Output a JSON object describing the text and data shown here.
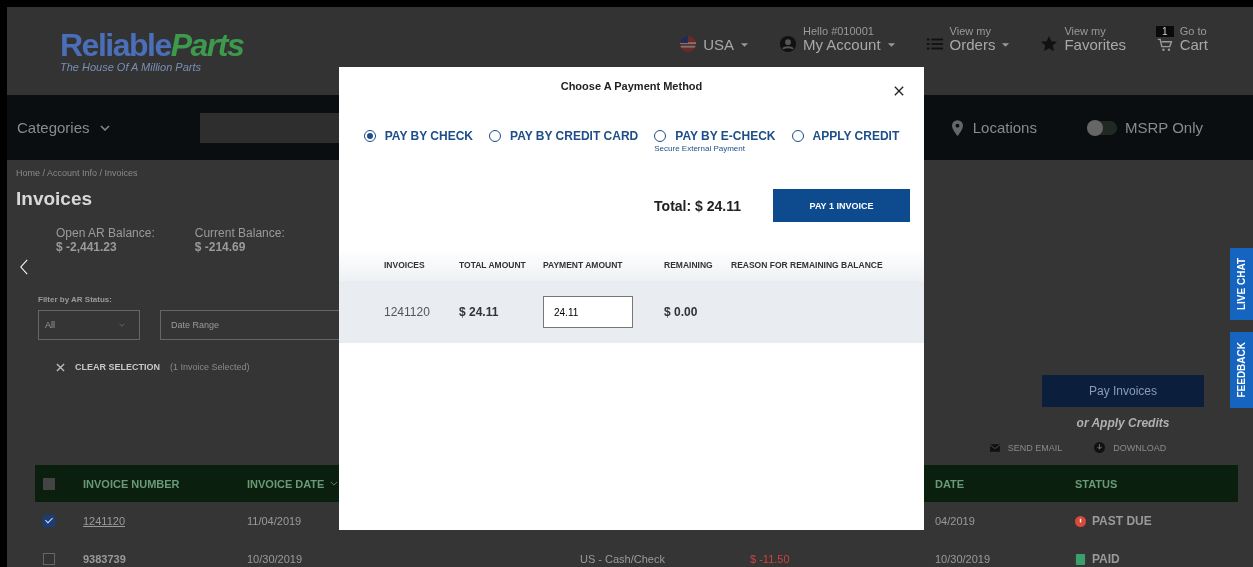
{
  "header": {
    "logo": {
      "brand": "Reliable",
      "accent": "Parts",
      "tagline": "The House Of A Million Parts"
    },
    "country": "USA",
    "account": {
      "small": "Hello #010001",
      "label": "My Account"
    },
    "orders": {
      "small": "View my",
      "label": "Orders"
    },
    "favorites": {
      "small": "View my",
      "label": "Favorites"
    },
    "cart": {
      "count": "1",
      "small": "Go to",
      "label": "Cart"
    }
  },
  "nav": {
    "categories": "Categories",
    "locations": "Locations",
    "msrp": {
      "label": "MSRP Only",
      "on": false
    }
  },
  "breadcrumb": "Home / Account Info / Invoices",
  "page_title": "Invoices",
  "balances": [
    {
      "label": "Open AR Balance:",
      "value": "$ -2,441.23"
    },
    {
      "label": "Current Balance:",
      "value": "$ -214.69"
    }
  ],
  "filter": {
    "label": "Filter by AR Status:",
    "status": "All",
    "date_placeholder": "Date Range"
  },
  "selection": {
    "action": "CLEAR SELECTION",
    "count": "(1 Invoice Selected)"
  },
  "actions": {
    "pay": "Pay Invoices",
    "apply": "or Apply Credits",
    "email": "SEND EMAIL",
    "download": "DOWNLOAD"
  },
  "table": {
    "all_checked": false,
    "columns": [
      "INVOICE NUMBER",
      "INVOICE DATE",
      "",
      "",
      "DATE",
      "STATUS"
    ],
    "rows": [
      {
        "checked": true,
        "number": "1241120",
        "date": "11/04/2019",
        "column_4": "",
        "column_5": "",
        "due": "04/2019",
        "status": "PAST DUE",
        "color": "#d84a3a",
        "kind": "alert"
      },
      {
        "checked": false,
        "number": "9383739",
        "date": "10/30/2019",
        "column_4": "US - Cash/Check",
        "column_5": "$ -11.50",
        "due": "10/30/2019",
        "status": "PAID",
        "color": "#3aa06a",
        "kind": "doc"
      }
    ]
  },
  "side_tabs": [
    "LIVE CHAT",
    "FEEDBACK"
  ],
  "modal": {
    "title": "Choose A Payment Method",
    "methods": [
      {
        "label": "PAY BY CHECK",
        "selected": true
      },
      {
        "label": "PAY BY CREDIT CARD",
        "selected": false
      },
      {
        "label": "PAY BY E-CHECK",
        "selected": false,
        "note": "Secure External Payment"
      },
      {
        "label": "APPLY CREDIT",
        "selected": false
      }
    ],
    "total": "Total: $ 24.11",
    "pay_button": "PAY 1 INVOICE",
    "columns": [
      "INVOICES",
      "TOTAL AMOUNT",
      "PAYMENT AMOUNT",
      "REMAINING",
      "REASON FOR REMAINING BALANCE"
    ],
    "rows": [
      {
        "invoice": "1241120",
        "total": "$ 24.11",
        "payment": "24.11",
        "remaining": "$ 0.00"
      }
    ]
  }
}
